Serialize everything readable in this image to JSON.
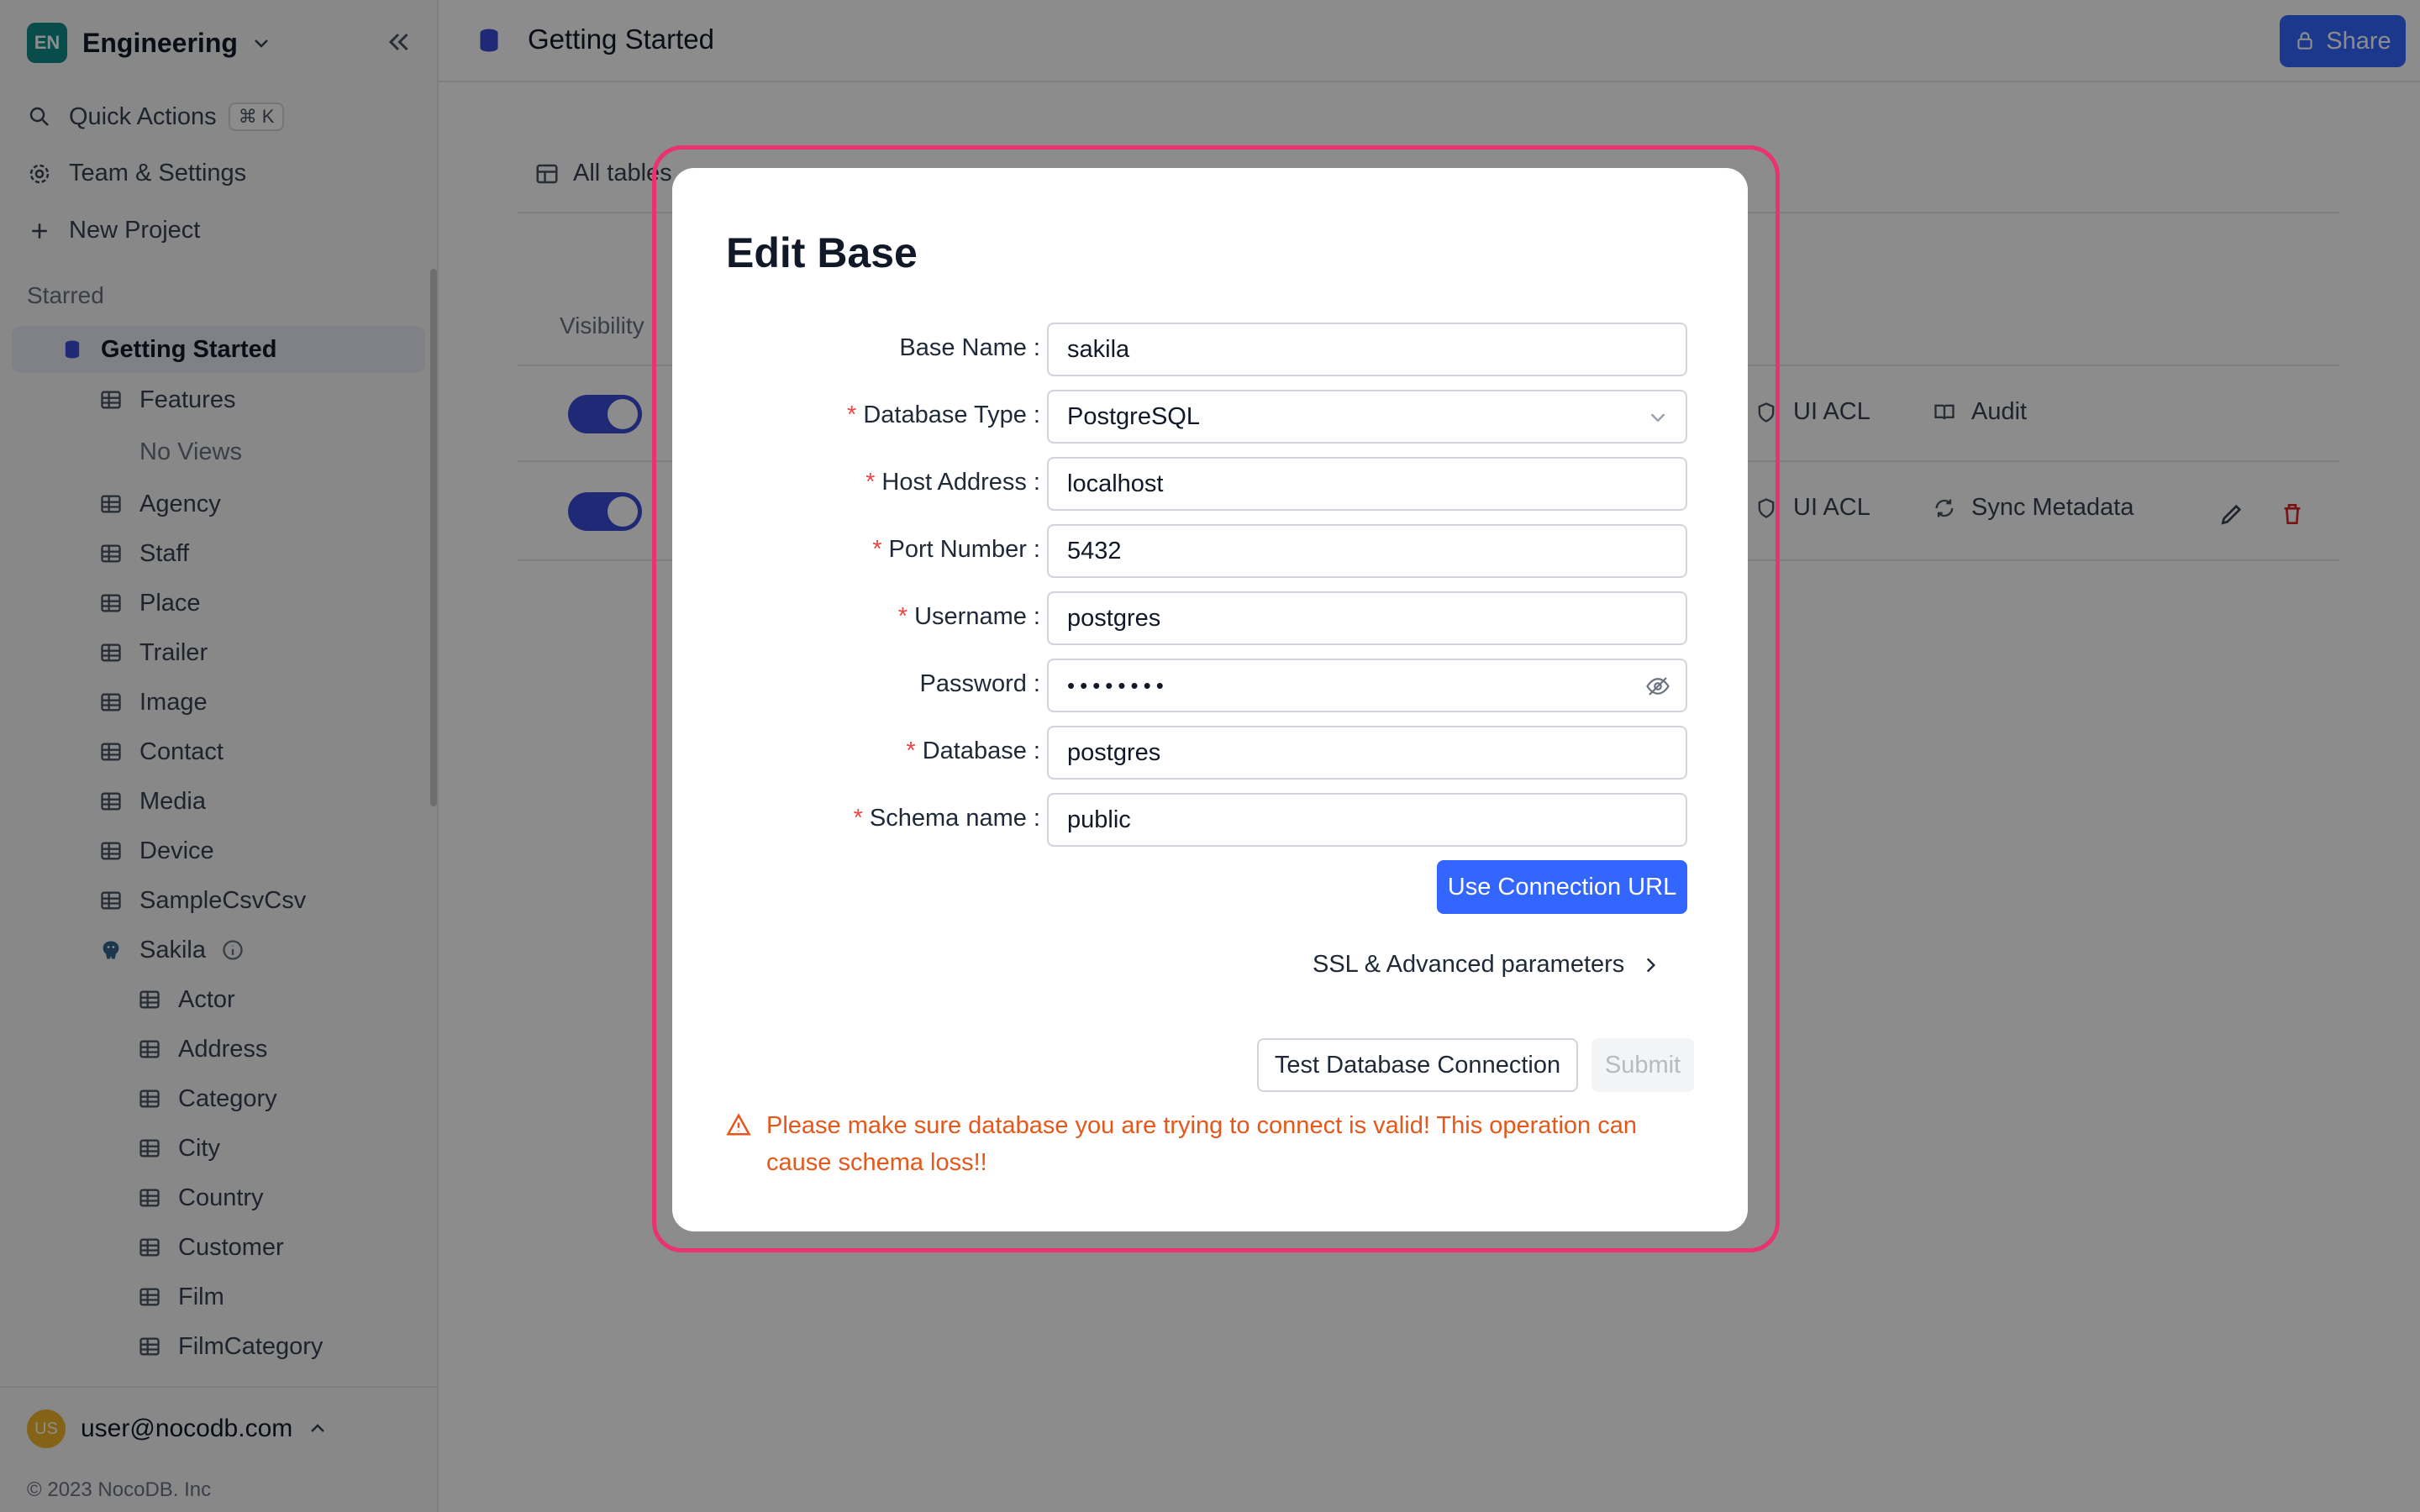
{
  "workspace": {
    "initials": "EN",
    "name": "Engineering"
  },
  "sidebar": {
    "quick_actions": "Quick Actions",
    "quick_actions_shortcut": "⌘ K",
    "team_settings": "Team & Settings",
    "new_project": "New Project",
    "starred_label": "Starred",
    "project": "Getting Started",
    "tables": [
      {
        "label": "Features"
      },
      {
        "label": "No Views"
      },
      {
        "label": "Agency"
      },
      {
        "label": "Staff"
      },
      {
        "label": "Place"
      },
      {
        "label": "Trailer"
      },
      {
        "label": "Image"
      },
      {
        "label": "Contact"
      },
      {
        "label": "Media"
      },
      {
        "label": "Device"
      },
      {
        "label": "SampleCsvCsv"
      }
    ],
    "external_base": "Sakila",
    "sakila_tables": [
      {
        "label": "Actor"
      },
      {
        "label": "Address"
      },
      {
        "label": "Category"
      },
      {
        "label": "City"
      },
      {
        "label": "Country"
      },
      {
        "label": "Customer"
      },
      {
        "label": "Film"
      },
      {
        "label": "FilmCategory"
      }
    ],
    "user_email": "user@nocodb.com",
    "user_initials": "US",
    "copyright": "© 2023 NocoDB. Inc"
  },
  "topbar": {
    "title": "Getting Started",
    "share": "Share"
  },
  "main": {
    "tab_all_tables": "All tables",
    "visibility_header": "Visibility",
    "rows": [
      {
        "action1": "UI ACL",
        "action2": "Audit"
      },
      {
        "action1": "UI ACL",
        "action2": "Sync Metadata"
      }
    ]
  },
  "modal": {
    "title": "Edit Base",
    "fields": {
      "base_name": {
        "label": "Base Name",
        "value": "sakila"
      },
      "database_type": {
        "label": "Database Type",
        "value": "PostgreSQL"
      },
      "host_address": {
        "label": "Host Address",
        "value": "localhost"
      },
      "port_number": {
        "label": "Port Number",
        "value": "5432"
      },
      "username": {
        "label": "Username",
        "value": "postgres"
      },
      "password": {
        "label": "Password",
        "value": "••••••••"
      },
      "database": {
        "label": "Database",
        "value": "postgres"
      },
      "schema_name": {
        "label": "Schema name",
        "value": "public"
      }
    },
    "use_connection_url": "Use Connection URL",
    "ssl_advanced": "SSL & Advanced parameters",
    "test_connection": "Test Database Connection",
    "submit": "Submit",
    "warning": "Please make sure database you are trying to connect is valid! This operation can cause schema loss!!"
  },
  "colors": {
    "accent": "#3366ff",
    "highlight_frame": "#e8336f",
    "warning": "#e5571a",
    "required": "#ef4444"
  }
}
